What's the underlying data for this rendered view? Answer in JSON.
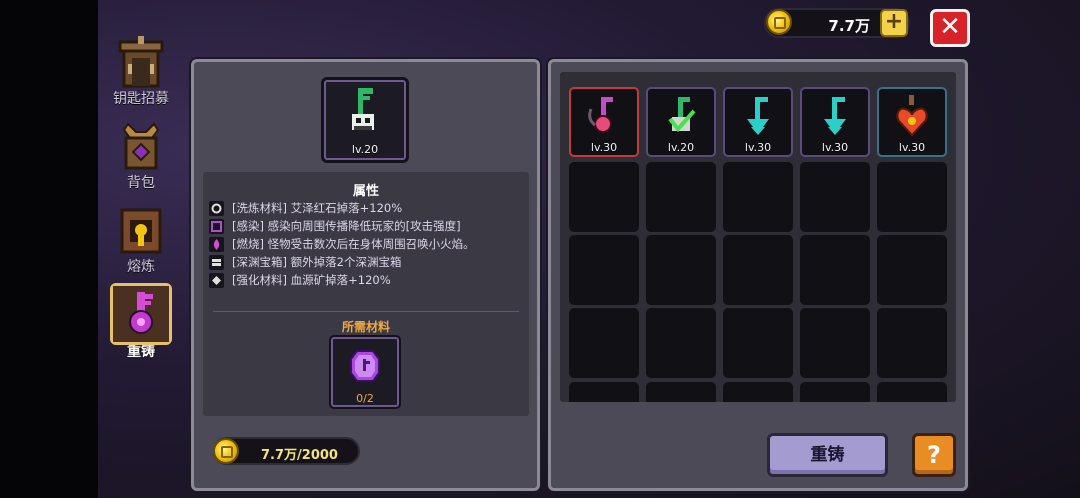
{
  "nav": {
    "items": [
      {
        "label": "钥匙招募"
      },
      {
        "label": "背包"
      },
      {
        "label": "熔炼"
      },
      {
        "label": "重铸"
      }
    ]
  },
  "currency": {
    "amount": "7.7万"
  },
  "close_label": "✕",
  "selected_item": {
    "level": "lv.20"
  },
  "attributes": {
    "title": "属性",
    "lines": [
      "[洗炼材料] 艾泽红石掉落+120%",
      "[感染] 感染向周围传播降低玩家的[攻击强度]",
      "[燃烧] 怪物受击数次后在身体周围召唤小火焰。",
      "[深渊宝箱] 额外掉落2个深渊宝箱",
      "[强化材料] 血源矿掉落+120%"
    ]
  },
  "materials": {
    "title": "所需材料",
    "count": "0/2"
  },
  "cost": {
    "text": "7.7万/2000"
  },
  "inventory": {
    "items": [
      {
        "level": "lv.30"
      },
      {
        "level": "lv.20"
      },
      {
        "level": "lv.30"
      },
      {
        "level": "lv.30"
      },
      {
        "level": "lv.30"
      }
    ]
  },
  "buttons": {
    "reforge": "重铸",
    "help": "?"
  },
  "colors": {
    "accent_orange": "#f2a93b",
    "coin_gold": "#f2c514",
    "close_red": "#d8222a",
    "button_purple": "#a49bd1"
  }
}
